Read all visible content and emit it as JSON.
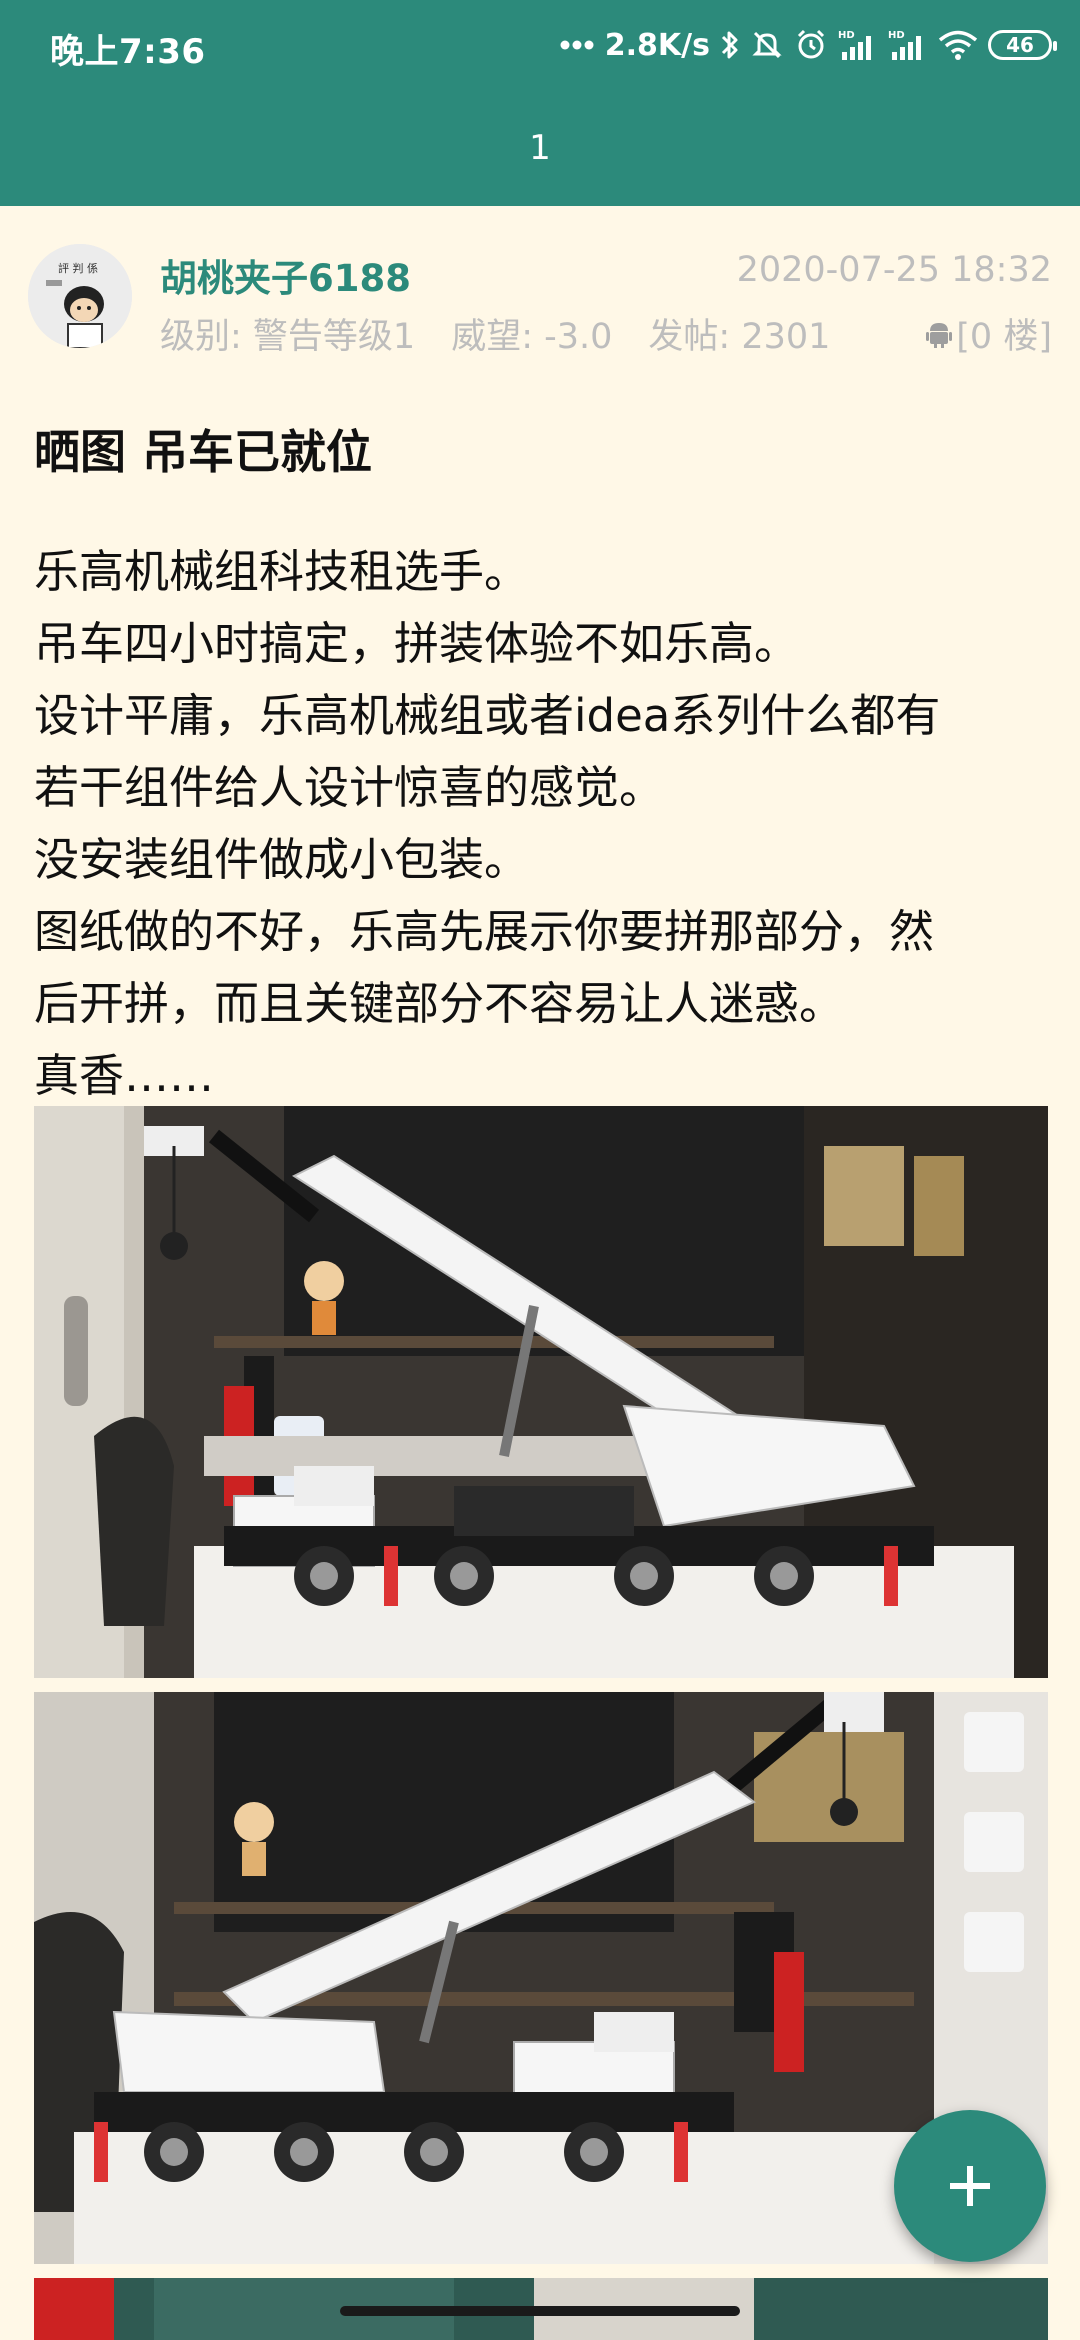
{
  "status_bar": {
    "time": "晚上7:36",
    "network_speed": "2.8K/s",
    "battery_level": "46",
    "icons": [
      "more-dots-icon",
      "bluetooth-icon",
      "mute-icon",
      "alarm-icon",
      "hd-signal-icon",
      "hd-signal-icon",
      "wifi-icon",
      "battery-icon"
    ]
  },
  "header": {
    "page_indicator": "1"
  },
  "post": {
    "author": "胡桃夹子6188",
    "timestamp": "2020-07-25 18:32",
    "level": "级别: 警告等级1",
    "prestige": "威望: -3.0",
    "post_count": "发帖: 2301",
    "floor": "[0 楼]",
    "device_icon": "android-icon",
    "title": "晒图 吊车已就位",
    "body_lines": [
      "乐高机械组科技租选手。",
      "吊车四小时搞定，拼装体验不如乐高。",
      "设计平庸，乐高机械组或者idea系列什么都有",
      "若干组件给人设计惊喜的感觉。",
      "没安装组件做成小包装。",
      "图纸做的不好，乐高先展示你要拼那部分，然",
      "后开拼，而且关键部分不容易让人迷惑。",
      "真香……"
    ],
    "images": [
      {
        "description_icon": "crane-photo-1"
      },
      {
        "description_icon": "crane-photo-2"
      },
      {
        "description_icon": "crane-photo-3"
      }
    ]
  },
  "fab": {
    "icon": "plus-icon"
  },
  "colors": {
    "primary": "#2C8A7B",
    "background": "#FFF8E7",
    "meta_text": "#BDBDBD"
  }
}
